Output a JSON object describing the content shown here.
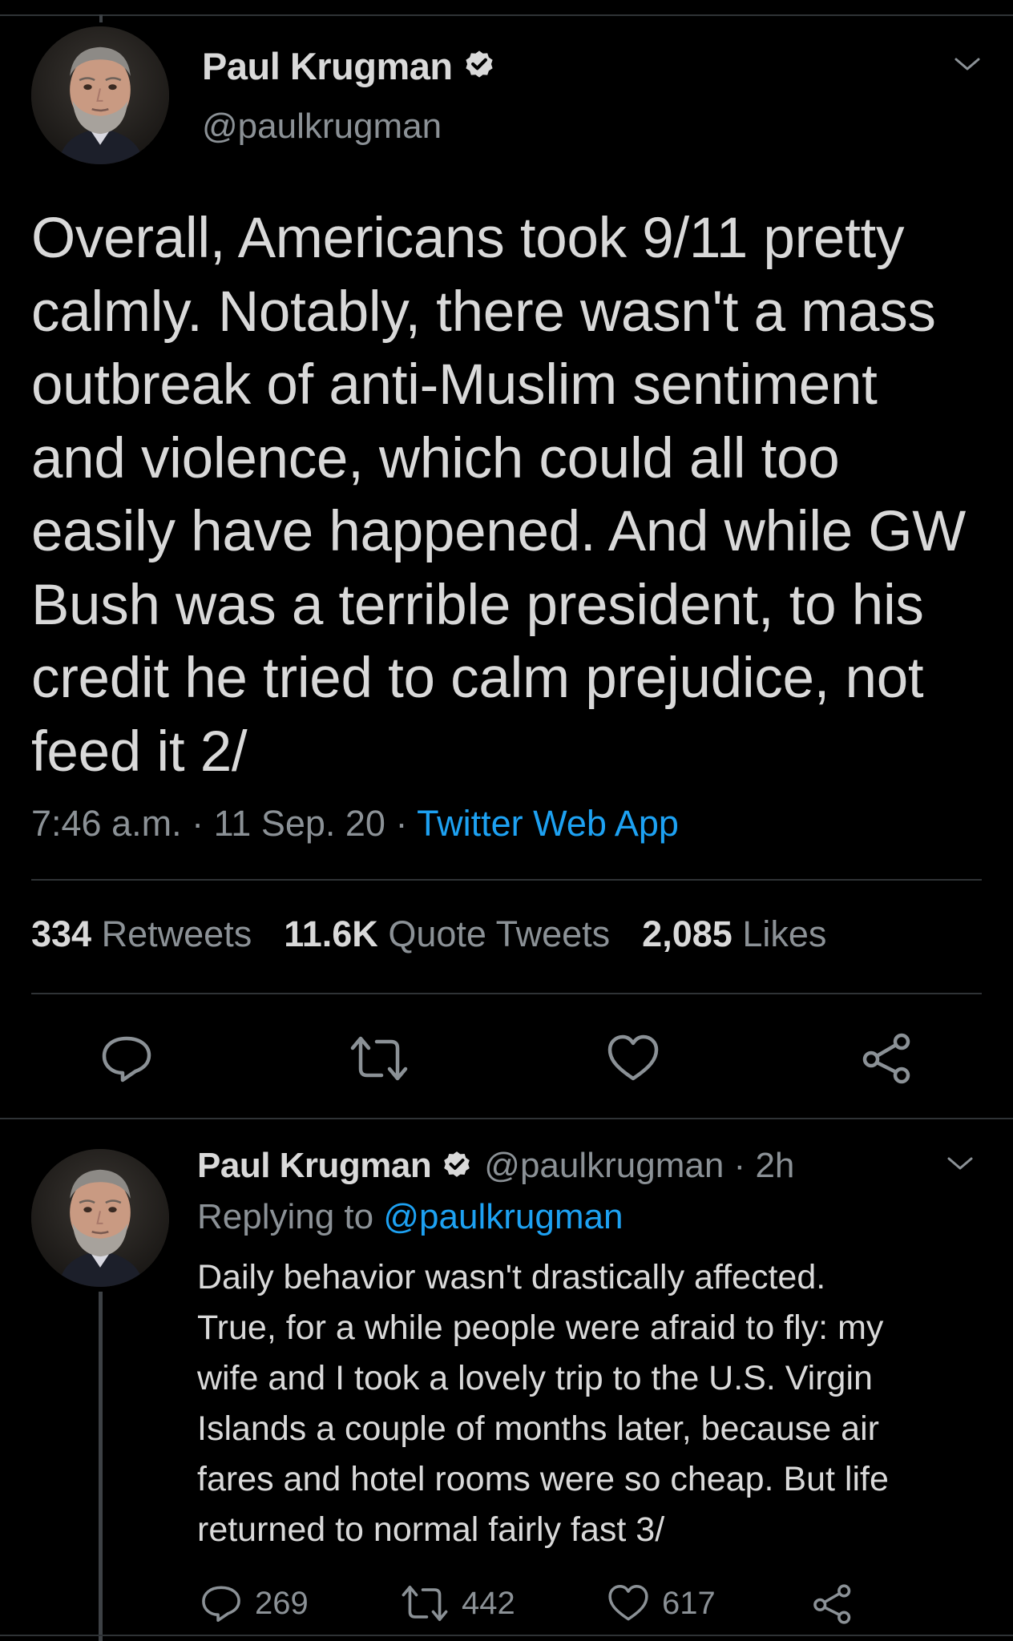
{
  "colors": {
    "background": "#000000",
    "text": "#d9d9d9",
    "secondary": "#8b9196",
    "link": "#1da1f2",
    "divider": "#2f3336"
  },
  "main_tweet": {
    "author_name": "Paul Krugman",
    "handle": "@paulkrugman",
    "verified": true,
    "text": "Overall, Americans took 9/11 pretty\ncalmly. Notably, there wasn't a mass\noutbreak of anti-Muslim sentiment\nand violence, which could all too\neasily have happened. And while GW\nBush was a terrible president, to his\ncredit he tried to calm prejudice, not\nfeed it 2/",
    "time": "7:46 a.m.",
    "date": "11 Sep. 20",
    "separator": " · ",
    "source": "Twitter Web App",
    "stats": {
      "retweets": {
        "count": "334",
        "label": "Retweets"
      },
      "quote_tweets": {
        "count": "11.6K",
        "label": "Quote Tweets"
      },
      "likes": {
        "count": "2,085",
        "label": "Likes"
      }
    },
    "icons": [
      "reply-icon",
      "retweet-icon",
      "like-icon",
      "share-icon"
    ]
  },
  "reply_tweet": {
    "author_name": "Paul Krugman",
    "handle": "@paulkrugman",
    "time_ago": "2h",
    "separator": " · ",
    "verified": true,
    "replying_label": "Replying to",
    "replying_to": "@paulkrugman",
    "text": "Daily behavior wasn't drastically affected.\nTrue, for a while people were afraid to fly: my\nwife and I took a lovely trip to the U.S. Virgin\nIslands a couple of months later, because air\nfares and hotel rooms were so cheap. But life\nreturned to normal fairly fast 3/",
    "counts": {
      "replies": "269",
      "retweets": "442",
      "likes": "617"
    }
  }
}
